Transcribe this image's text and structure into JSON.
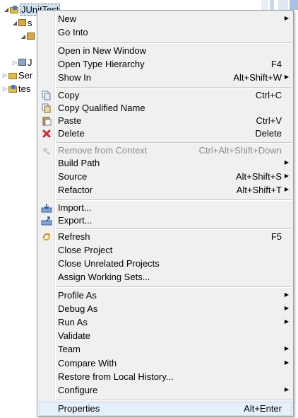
{
  "tree": {
    "selected_project": "JUnitTest",
    "row2": "s",
    "row4": "J",
    "row5": "Ser",
    "row6": "tes"
  },
  "menu": {
    "new": {
      "label": "New"
    },
    "go_into": {
      "label": "Go Into"
    },
    "open_new_window": {
      "label": "Open in New Window"
    },
    "open_type_hierarchy": {
      "label": "Open Type Hierarchy",
      "accel": "F4"
    },
    "show_in": {
      "label": "Show In",
      "accel": "Alt+Shift+W"
    },
    "copy": {
      "label": "Copy",
      "accel": "Ctrl+C",
      "icon": "copy-icon"
    },
    "copy_qualified_name": {
      "label": "Copy Qualified Name",
      "icon": "copy-qualified-name-icon"
    },
    "paste": {
      "label": "Paste",
      "accel": "Ctrl+V",
      "icon": "paste-icon"
    },
    "delete": {
      "label": "Delete",
      "accel": "Delete",
      "icon": "delete-icon"
    },
    "remove_from_context": {
      "label": "Remove from Context",
      "accel": "Ctrl+Alt+Shift+Down",
      "icon": "remove-context-icon"
    },
    "build_path": {
      "label": "Build Path"
    },
    "source": {
      "label": "Source",
      "accel": "Alt+Shift+S"
    },
    "refactor": {
      "label": "Refactor",
      "accel": "Alt+Shift+T"
    },
    "import": {
      "label": "Import...",
      "icon": "import-icon"
    },
    "export": {
      "label": "Export...",
      "icon": "export-icon"
    },
    "refresh": {
      "label": "Refresh",
      "accel": "F5",
      "icon": "refresh-icon"
    },
    "close_project": {
      "label": "Close Project"
    },
    "close_unrelated": {
      "label": "Close Unrelated Projects"
    },
    "assign_working_sets": {
      "label": "Assign Working Sets..."
    },
    "profile_as": {
      "label": "Profile As"
    },
    "debug_as": {
      "label": "Debug As"
    },
    "run_as": {
      "label": "Run As"
    },
    "validate": {
      "label": "Validate"
    },
    "team": {
      "label": "Team"
    },
    "compare_with": {
      "label": "Compare With"
    },
    "restore_local_history": {
      "label": "Restore from Local History..."
    },
    "configure": {
      "label": "Configure"
    },
    "properties": {
      "label": "Properties",
      "accel": "Alt+Enter"
    }
  },
  "colors": {
    "menu_bg": "#f0f0f0",
    "hover_bg": "#e5f0fb",
    "disabled_text": "#8d8d8d",
    "delete_icon": "#d52b2b"
  }
}
